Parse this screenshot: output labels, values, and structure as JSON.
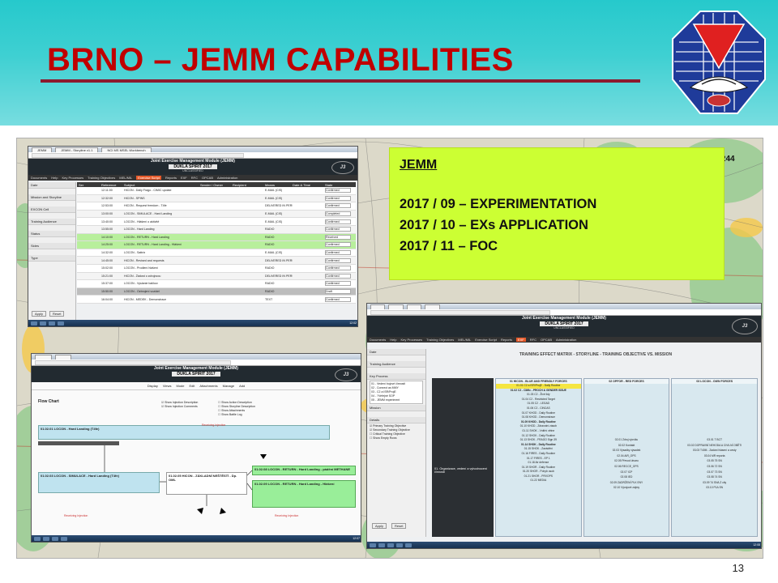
{
  "slide": {
    "title": "BRNO – JEMM CAPABILITIES",
    "page_number": "13"
  },
  "colors": {
    "header_teal": "#2ec9cc",
    "title_red": "#c00000",
    "rule": "#8b1a2e",
    "info_box": "#ccff33"
  },
  "info_box": {
    "heading": "JEMM",
    "lines": [
      "2017 / 09 –  EXPERIMENTATION",
      "2017 / 10 –  EXs APPLICATION",
      "2017 / 11 –  FOC"
    ]
  },
  "map": {
    "label": "63.244"
  },
  "shot1": {
    "tabs": [
      "JEMM",
      "JEMM - Storyline v1.1",
      "NCI MS MSEL Workbench"
    ],
    "app_title": "Joint Exercise Management Module (JEMM)",
    "exercise": "DUKLA SPIRIT 2017",
    "classification": "UNCLASSIFIED",
    "menu": [
      "Documents",
      "Help",
      "Key Processes",
      "Training Objectives",
      "MEL/MIL",
      "Exercise Script",
      "Reports",
      "EXF",
      "RFC",
      "OPCAB",
      "Administration"
    ],
    "sidebar": [
      "Date",
      "Mission and Storyline",
      "EXCON Cell",
      "Training Audience",
      "Status",
      "Sides",
      "Type"
    ],
    "columns": [
      "Ser",
      "Reference",
      "Subject",
      "Sender / Owner",
      "Recipient",
      "Means",
      "Date & Time",
      "State"
    ],
    "rows": [
      {
        "time": "12:11:00",
        "subject": "HICON - Daily Frago - CIMIC update",
        "means": "E-MAIL (CIS)",
        "state": "Confirmed"
      },
      {
        "time": "12:32:00",
        "subject": "HICON - SPINS",
        "means": "E-MAIL (CIS)",
        "state": "Confirmed"
      },
      {
        "time": "12:53:00",
        "subject": "HICON - Request freedom - T4fe",
        "means": "DELIVERED IN PERSON",
        "state": "Confirmed"
      },
      {
        "time": "13:00:00",
        "subject": "LOCON - SIMULACE - Hard Landing",
        "means": "E-MAIL (CIS)",
        "state": "Completed"
      },
      {
        "time": "13:40:00",
        "subject": "LOCON - Hlášení o aktivitě",
        "means": "E-MAIL (CIS)",
        "state": "Confirmed"
      },
      {
        "time": "13:55:00",
        "subject": "LOCON - Hard Landing",
        "means": "RADIO",
        "state": "Confirmed"
      },
      {
        "time": "14:10:00",
        "subject": "LOCON - RETURN - Hard Landing",
        "means": "RADIO",
        "state": "Received"
      },
      {
        "time": "14:25:00",
        "subject": "LOCON - RETURN - Hard Landing - Hlášení",
        "means": "RADIO",
        "state": "Confirmed"
      },
      {
        "time": "14:32:00",
        "subject": "LOCON - Sattrix",
        "means": "E-MAIL (CIS)",
        "state": "Confirmed"
      },
      {
        "time": "14:45:00",
        "subject": "HICON - Revised and requests",
        "means": "DELIVERED IN PERSON",
        "state": "Confirmed"
      },
      {
        "time": "15:02:00",
        "subject": "LOCON - Prodlení hlášení",
        "means": "RADIO",
        "state": "Confirmed"
      },
      {
        "time": "15:21:00",
        "subject": "HICON - Žádost o zdrojovou",
        "means": "DELIVERED IN PERSON",
        "state": "Confirmed"
      },
      {
        "time": "15:37:00",
        "subject": "LOCON - Vyslanie balíkov",
        "means": "RADIO",
        "state": "Confirmed"
      },
      {
        "time": "15:50:00",
        "subject": "LOCON - Ozbrojení vozidel",
        "means": "RADIO",
        "state": "Draft"
      },
      {
        "time": "16:04:00",
        "subject": "HICON - MEDEK - Demonstrace",
        "means": "TEXT",
        "state": "Confirmed"
      }
    ],
    "buttons": {
      "apply": "Apply",
      "reset": "Reset"
    },
    "clock": "12:02"
  },
  "shot2": {
    "app_title": "Joint Exercise Management Module (JEMM)",
    "exercise": "DUKLA SPIRIT 2017",
    "menu": [
      "Display",
      "Views",
      "Mode",
      "Edit",
      "Attachments",
      "Manage",
      "Add"
    ],
    "flow_title": "Flow Chart",
    "options": [
      "Show Injection Description",
      "Show Injection Comments",
      "Show Action Description",
      "Show Storyline Description",
      "Show Attachments",
      "Show Battle Log"
    ],
    "boxes": {
      "top": "01.02.01 LOCON - Hard Landing (T4fe)",
      "left": "01.02.03 LOCON - SIMULACE - Hard Landing (T4fe)",
      "mid": "01.02.05 HICON - ZÁKLADNÍ NEŠTĚSTÍ - Dp. OML",
      "right1": "01.02.08 LOCON - RETURN - Hard Landing - pádění METHANE",
      "right2": "01.02.09 LOCON - RETURN - Hard Landing - Hlášení"
    },
    "notes": {
      "left": "Receiving Injection",
      "right": "Receiving Injection",
      "bottom": "Receiving Injection"
    },
    "clock": "12:07"
  },
  "shot3": {
    "app_title": "Joint Exercise Management Module (JEMM)",
    "exercise": "DUKLA SPIRIT 2017",
    "classification": "UNCLASSIFIED",
    "menu": [
      "Documents",
      "Help",
      "Key Processes",
      "Training Objectives",
      "MEL/MIL",
      "Exercise Script",
      "Reports",
      "EXF",
      "RFC",
      "OPCAB",
      "Administration"
    ],
    "matrix_title": "TRAINING EFFECT MATRIX - STORYLINE - TRAINING OBJECTIVE VS. MISSION",
    "col_headers": [
      "01 HICON - BLUE AND FRIENDLY FORCES",
      "02 OPFOR - RED FORCES",
      "03 LOCON - OWN FORCES"
    ],
    "row_label": "01. Organizace, vedení a vyhodnocení činnosti",
    "sidebar": [
      "Date",
      "Training Audience",
      "Key Process",
      "Mission",
      "Details"
    ],
    "key_process": [
      "01 - Vedení bojové činnosti",
      "02 - Connect as MMY",
      "03 - C2 a ISR/ProjE",
      "04 - ?Veřejné SOP",
      "05 - JEMM experiment"
    ],
    "details": [
      "Primary Training Objective",
      "Secondary Training Objective",
      "Critical Training Objective",
      "Show Empty Rows"
    ],
    "col1_items": [
      "01.01 C2 a ISR/ProjE - Daily Routine",
      "01.02 C2 - CIMIc - PROCH & GENDER ISSUE",
      "01.03 C2 - Živé lidy",
      "01.04 C2 - Restricted Target",
      "01.05 C2 - LEGAD",
      "01.06 C2 - CINCAS",
      "01.07 KHOD - Daily Routine",
      "01.08 KHOD - Demonstrace",
      "01.09 KHOD - Daily Routine",
      "01.10 KHOD - Zdravotní zásob",
      "01.11 SHOK - Vnitřní větne",
      "01.12 SHOK - Daily Routine",
      "01.13 SHOK - FRAGO Sign 39",
      "01.14 SHOK - Daily Routine",
      "01.15 SHOK - Zavádění",
      "01.16 FIRES - Daily Routine",
      "01.17 FIRES - EP 1",
      "01.18 Air defense",
      "01.19 SHOR - Daily Routine",
      "01.20 SHOR - Pohyb osob",
      "01.21 SHOR - PRVOPS",
      "01.22 MEDIA"
    ],
    "col2_items": [
      "02.01 Zdroj výcviku",
      "02.02 Kontakt",
      "02.03 Výsadky výsadek",
      "02.04 AIR_OPS",
      "02.05 Převod útvaru",
      "02.06 RECCE_OPS",
      "02.07 ICP",
      "02.08 IED",
      "02.09 ZADRŽENÍ PLK ENY",
      "02.10 Vývojové zájmy"
    ],
    "col3_items": [
      "03.01 T BCT",
      "03.02 DOPRAVNÍ NEHODA A CIVILNÍ OBĚTI",
      "03.03 T40M - Zadání hlásení a cesty",
      "03.04 MR reporta",
      "03.05 75 SN",
      "03.06 72 SN",
      "03.07 73 SN",
      "03.08 74 SN",
      "03.09 74 SN/LZ city",
      "03.10 P1A SN"
    ],
    "buttons": {
      "apply": "Apply",
      "reset": "Reset"
    },
    "clock": "12:08"
  }
}
